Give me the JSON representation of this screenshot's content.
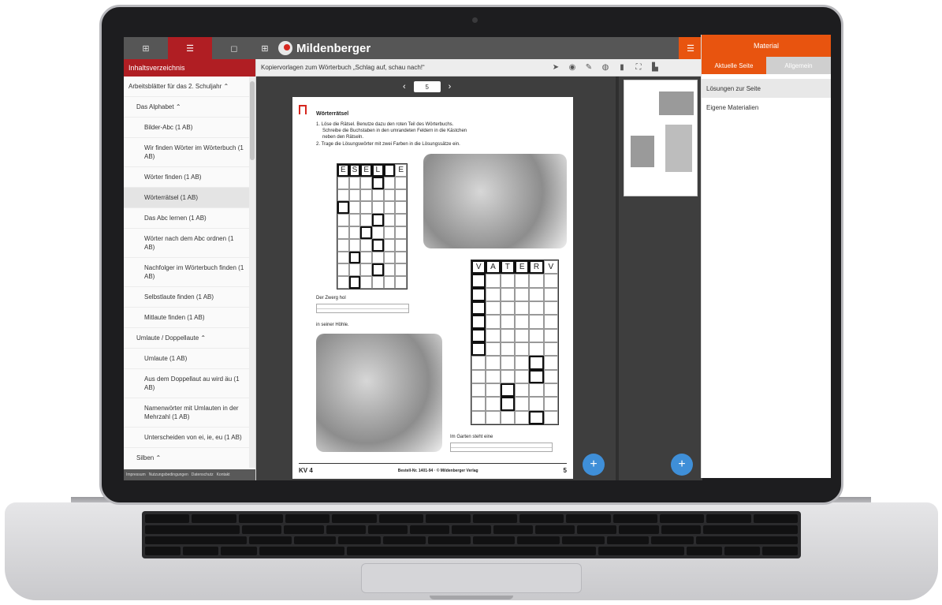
{
  "left_tabs": [
    {
      "icon": "grid-icon",
      "glyph": "⊞"
    },
    {
      "icon": "list-icon",
      "glyph": "☰"
    },
    {
      "icon": "bookmark-icon",
      "glyph": "◻"
    }
  ],
  "brand": {
    "name": "Mildenberger",
    "accent": "#b01e23",
    "material_accent": "#e8540f"
  },
  "sidebar": {
    "title": "Inhaltsverzeichnis",
    "items": [
      {
        "label": "Arbeitsblätter für das 2. Schuljahr ⌃",
        "level": 0
      },
      {
        "label": "Das Alphabet ⌃",
        "level": 1
      },
      {
        "label": "Bilder-Abc (1 AB)",
        "level": 2
      },
      {
        "label": "Wir finden Wörter im Wörterbuch (1 AB)",
        "level": 2
      },
      {
        "label": "Wörter finden (1 AB)",
        "level": 2
      },
      {
        "label": "Wörterrätsel (1 AB)",
        "level": 2,
        "active": true
      },
      {
        "label": "Das Abc lernen (1 AB)",
        "level": 2
      },
      {
        "label": "Wörter nach dem Abc ordnen (1 AB)",
        "level": 2
      },
      {
        "label": "Nachfolger im Wörterbuch finden (1 AB)",
        "level": 2
      },
      {
        "label": "Selbstlaute finden (1 AB)",
        "level": 2
      },
      {
        "label": "Mitlaute finden (1 AB)",
        "level": 2
      },
      {
        "label": "Umlaute / Doppellaute ⌃",
        "level": 1
      },
      {
        "label": "Umlaute (1 AB)",
        "level": 2
      },
      {
        "label": "Aus dem Doppellaut au wird äu (1 AB)",
        "level": 2
      },
      {
        "label": "Namenwörter mit Umlauten in der Mehrzahl (1 AB)",
        "level": 2
      },
      {
        "label": "Unterscheiden von ei, ie, eu (1 AB)",
        "level": 2
      },
      {
        "label": "Silben ⌃",
        "level": 1
      }
    ],
    "footer": [
      "Impressum",
      "Nutzungsbedingungen",
      "Datenschutz",
      "Kontakt"
    ]
  },
  "document": {
    "title": "Kopiervorlagen zum Wörterbuch „Schlag auf, schau nach!“",
    "page_number": "5",
    "prev": "‹",
    "next": "›"
  },
  "toolbar": [
    {
      "icon": "pointer-icon",
      "glyph": "➤"
    },
    {
      "icon": "eye-icon",
      "glyph": "◉"
    },
    {
      "icon": "pen-icon",
      "glyph": "✎"
    },
    {
      "icon": "palette-icon",
      "glyph": "◍"
    },
    {
      "icon": "trash-icon",
      "glyph": "▮"
    },
    {
      "icon": "expand-icon",
      "glyph": "⛶"
    },
    {
      "icon": "file-icon",
      "glyph": "▙"
    }
  ],
  "worksheet": {
    "title": "Wörterrätsel",
    "line1": "1. Löse die Rätsel. Benutze dazu den roten Teil des Wörterbuchs.",
    "line2": "Schreibe die Buchstaben in den umrandeten Feldern in die Kästchen",
    "line3": "neben den Rätseln.",
    "line4": "2. Trage die Lösungswörter mit zwei Farben in die Lösungssätze ein.",
    "grid1_letters": [
      "E",
      "S",
      "E",
      "L",
      "",
      "E"
    ],
    "grid2_letters": [
      "V",
      "A",
      "T",
      "E",
      "R",
      "V"
    ],
    "sentence1a": "Der Zwerg hol",
    "sentence1b": "in seiner Höhle.",
    "sentence2": "Im Garten steht eine",
    "footer_left": "KV 4",
    "footer_mid": "Bestell-Nr. 1401-94 · © Mildenberger Verlag",
    "footer_right": "5"
  },
  "material": {
    "header": "Material",
    "tabs": [
      {
        "label": "Aktuelle Seite",
        "active": true
      },
      {
        "label": "Allgemein",
        "active": false
      }
    ],
    "items": [
      "Lösungen zur Seite",
      "Eigene Materialien"
    ]
  },
  "fab_label": "+"
}
